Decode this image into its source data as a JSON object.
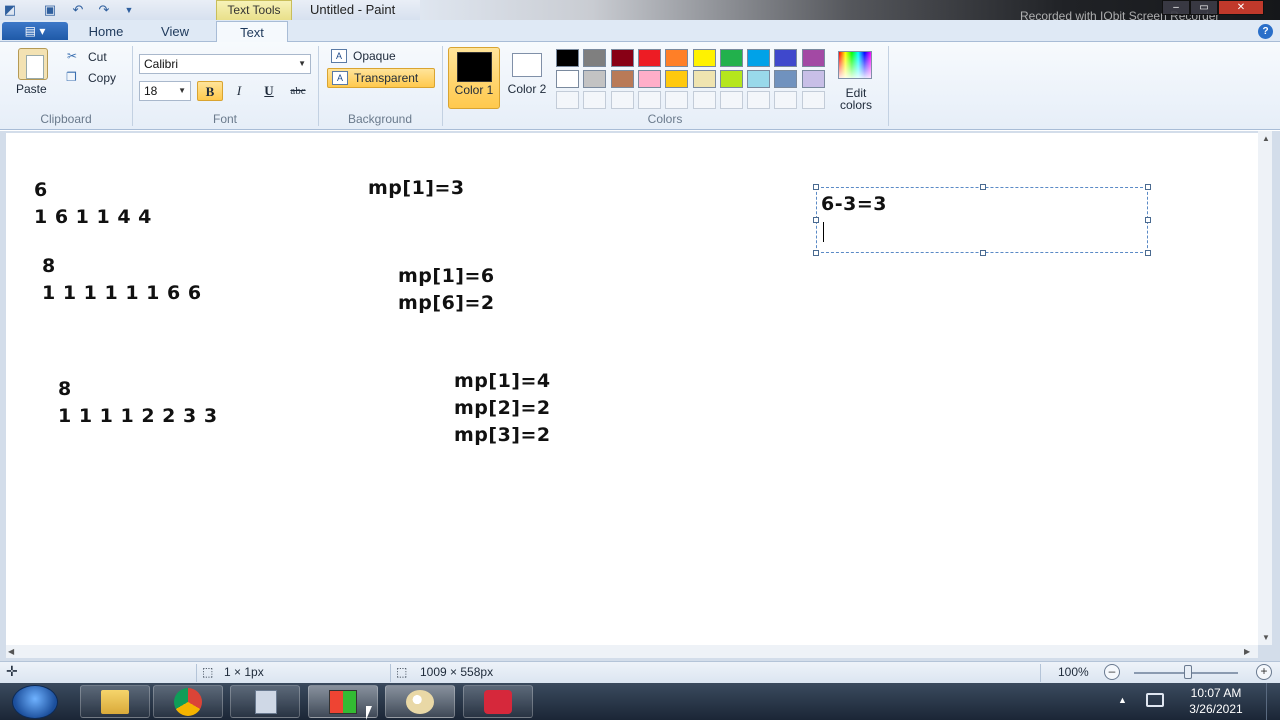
{
  "window": {
    "title": "Untitled - Paint",
    "context_tab": "Text Tools",
    "watermark": "Recorded with IObit Screen Recorder"
  },
  "tabs": [
    {
      "label": "Home"
    },
    {
      "label": "View"
    },
    {
      "label": "Text"
    }
  ],
  "ribbon": {
    "clipboard": {
      "paste": "Paste",
      "cut": "Cut",
      "copy": "Copy",
      "group": "Clipboard"
    },
    "font": {
      "name": "Calibri",
      "size": "18",
      "bold": "B",
      "italic": "I",
      "underline": "U",
      "strike": "abc",
      "group": "Font"
    },
    "background": {
      "opaque": "Opaque",
      "transparent": "Transparent",
      "group": "Background"
    },
    "colors": {
      "color1": "Color 1",
      "color2": "Color 2",
      "edit": "Edit colors",
      "group": "Colors",
      "color1_value": "#000000",
      "color2_value": "#ffffff",
      "palette_row1": [
        "#000000",
        "#7f7f7f",
        "#880015",
        "#ed1c24",
        "#ff7f27",
        "#fff200",
        "#22b14c",
        "#00a2e8",
        "#3f48cc",
        "#a349a4"
      ],
      "palette_row2": [
        "#ffffff",
        "#c3c3c3",
        "#b97a57",
        "#ffaec9",
        "#ffc90e",
        "#efe4b0",
        "#b5e61d",
        "#99d9ea",
        "#7092be",
        "#c8bfe7"
      ]
    }
  },
  "canvas_text": {
    "block1_line1": "6",
    "block1_line2": "1 6 1 1 4 4",
    "block2_line1": "8",
    "block2_line2": "1 1 1 1 1 1 6 6",
    "block3_line1": "8",
    "block3_line2": "1 1 1 1 2 2 3 3",
    "map1_line1": "mp[1]=3",
    "map2_line1": "mp[1]=6",
    "map2_line2": "mp[6]=2",
    "map3_line1": "mp[1]=4",
    "map3_line2": "mp[2]=2",
    "map3_line3": "mp[3]=2",
    "textbox_line1": "6-3=3"
  },
  "statusbar": {
    "cursor_pos": "1 × 1px",
    "canvas_size": "1009 × 558px",
    "zoom": "100%"
  },
  "taskbar": {
    "time": "10:07 AM",
    "date": "3/26/2021"
  }
}
